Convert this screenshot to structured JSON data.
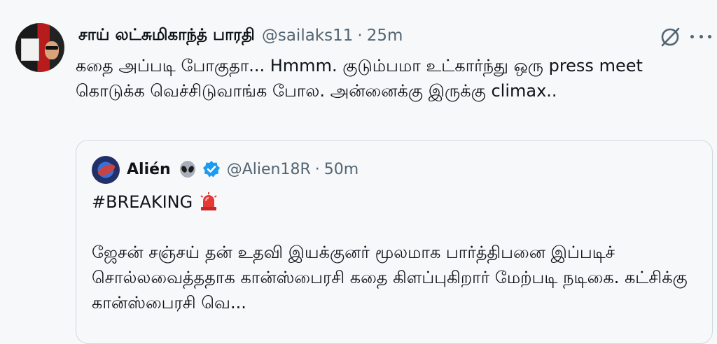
{
  "tweet": {
    "display_name": "சாய் லட்சுமிகாந்த் பாரதி",
    "handle": "@sailaks11",
    "separator": "·",
    "time": "25m",
    "text": "கதை அப்படி போகுதா... Hmmm. குடும்பமா உட்கார்ந்து ஒரு press meet கொடுக்க வெச்சிடுவாங்க போல. அன்னைக்கு இருக்கு climax..",
    "icons": {
      "grok": "grok-icon",
      "more": "more-dots-icon",
      "avatar": "user-avatar"
    }
  },
  "quote": {
    "display_name": "Alién",
    "handle": "@Alien18R",
    "separator": "·",
    "time": "50m",
    "hashtag": "#BREAKING",
    "text": "ஜேசன் சஞ்சய் தன் உதவி இயக்குனர் மூலமாக பார்த்திபனை இப்படிச் சொல்லவைத்ததாக கான்ஸ்பைரசி கதை கிளப்புகிறார் மேற்படி நடிகை.  கட்சிக்கு கான்ஸ்பைரசி வெ...",
    "icons": {
      "alien": "alien-emoji-icon",
      "verified": "verified-badge-icon",
      "siren": "siren-emoji-icon"
    }
  },
  "colors": {
    "text": "#0f1419",
    "secondary": "#536471",
    "verified": "#1d9bf0",
    "border": "#cfd9de"
  }
}
